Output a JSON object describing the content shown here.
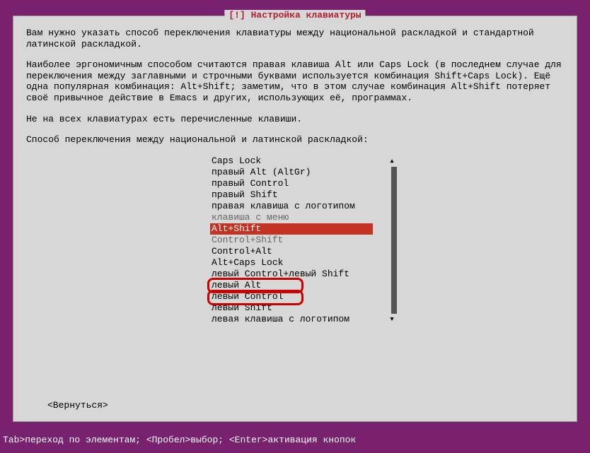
{
  "dialog": {
    "title": "[!] Настройка клавиатуры",
    "para1": "Вам нужно указать способ переключения клавиатуры между национальной раскладкой и стандартной латинской раскладкой.",
    "para2": "Наиболее эргономичным способом считаются правая клавиша Alt или Caps Lock (в последнем случае для переключения между заглавными и строчными буквами используется комбинация Shift+Caps Lock). Ещё одна популярная комбинация: Alt+Shift; заметим, что в этом случае комбинация Alt+Shift потеряет своё привычное действие в Emacs и других, использующих её, программах.",
    "para3": "Не на всех клавиатурах есть перечисленные клавиши.",
    "para4": "Способ переключения между национальной и латинской раскладкой:",
    "back": "<Вернуться>"
  },
  "options": [
    {
      "label": "Caps Lock",
      "state": "normal"
    },
    {
      "label": "правый Alt (AltGr)",
      "state": "normal"
    },
    {
      "label": "правый Control",
      "state": "normal"
    },
    {
      "label": "правый Shift",
      "state": "normal"
    },
    {
      "label": "правая клавиша с логотипом",
      "state": "normal"
    },
    {
      "label": "клавиша с меню",
      "state": "partial"
    },
    {
      "label": "Alt+Shift",
      "state": "selected"
    },
    {
      "label": "Control+Shift",
      "state": "partial"
    },
    {
      "label": "Control+Alt",
      "state": "normal"
    },
    {
      "label": "Alt+Caps Lock",
      "state": "normal"
    },
    {
      "label": "левый Control+левый Shift",
      "state": "normal"
    },
    {
      "label": "левый Alt",
      "state": "normal"
    },
    {
      "label": "левый Control",
      "state": "normal"
    },
    {
      "label": "левый Shift",
      "state": "normal"
    },
    {
      "label": "левая клавиша с логотипом",
      "state": "normal"
    }
  ],
  "scroll": {
    "up": "▴",
    "down": "▾"
  },
  "status": "Tab>переход по элементам; <Пробел>выбор; <Enter>активация кнопок"
}
